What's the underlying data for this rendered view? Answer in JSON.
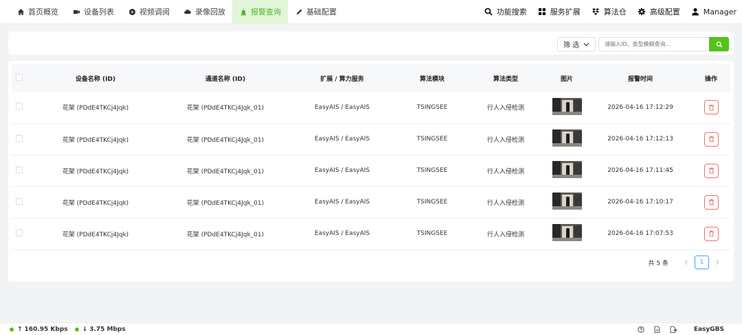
{
  "nav": {
    "items": [
      {
        "label": "首页概览",
        "icon": "home-icon"
      },
      {
        "label": "设备列表",
        "icon": "camera-icon"
      },
      {
        "label": "视频调阅",
        "icon": "play-icon"
      },
      {
        "label": "录像回放",
        "icon": "cloud-icon"
      },
      {
        "label": "报警查询",
        "icon": "alarm-icon",
        "active": true
      },
      {
        "label": "基础配置",
        "icon": "edit-icon"
      }
    ],
    "right": [
      {
        "label": "功能搜索",
        "icon": "search-icon"
      },
      {
        "label": "服务扩展",
        "icon": "grid-icon"
      },
      {
        "label": "算法仓",
        "icon": "dropbox-icon"
      },
      {
        "label": "高级配置",
        "icon": "gear-icon"
      },
      {
        "label": "Manager",
        "icon": "user-icon"
      }
    ]
  },
  "filter": {
    "select_label": "筛 选",
    "search_placeholder": "请输入ID、类型模糊查询..."
  },
  "table": {
    "headers": [
      "设备名称 (ID)",
      "通道名称 (ID)",
      "扩展 / 算力服务",
      "算法模块",
      "算法类型",
      "图片",
      "报警时间",
      "操作"
    ],
    "rows": [
      {
        "device": "花架 (PDdE4TKCj4Jqk)",
        "channel": "花架 (PDdE4TKCj4Jqk_01)",
        "service": "EasyAIS / EasyAIS",
        "module": "TSINGSEE",
        "type": "行人入侵检测",
        "time": "2026-04-16 17:12:29"
      },
      {
        "device": "花架 (PDdE4TKCj4Jqk)",
        "channel": "花架 (PDdE4TKCj4Jqk_01)",
        "service": "EasyAIS / EasyAIS",
        "module": "TSINGSEE",
        "type": "行人入侵检测",
        "time": "2026-04-16 17:12:13"
      },
      {
        "device": "花架 (PDdE4TKCj4Jqk)",
        "channel": "花架 (PDdE4TKCj4Jqk_01)",
        "service": "EasyAIS / EasyAIS",
        "module": "TSINGSEE",
        "type": "行人入侵检测",
        "time": "2026-04-16 17:11:45"
      },
      {
        "device": "花架 (PDdE4TKCj4Jqk)",
        "channel": "花架 (PDdE4TKCj4Jqk_01)",
        "service": "EasyAIS / EasyAIS",
        "module": "TSINGSEE",
        "type": "行人入侵检测",
        "time": "2026-04-16 17:10:17"
      },
      {
        "device": "花架 (PDdE4TKCj4Jqk)",
        "channel": "花架 (PDdE4TKCj4Jqk_01)",
        "service": "EasyAIS / EasyAIS",
        "module": "TSINGSEE",
        "type": "行人入侵检测",
        "time": "2026-04-16 17:07:53"
      }
    ]
  },
  "pagination": {
    "total": "共 5 条",
    "current": "1"
  },
  "status": {
    "upload": "160.95 Kbps",
    "download": "3.75 Mbps",
    "brand": "EasyGBS"
  },
  "colors": {
    "accent": "#52c41a",
    "active_bg": "#e3f5d8",
    "danger": "#f56c6c",
    "page_active": "#409eff"
  }
}
